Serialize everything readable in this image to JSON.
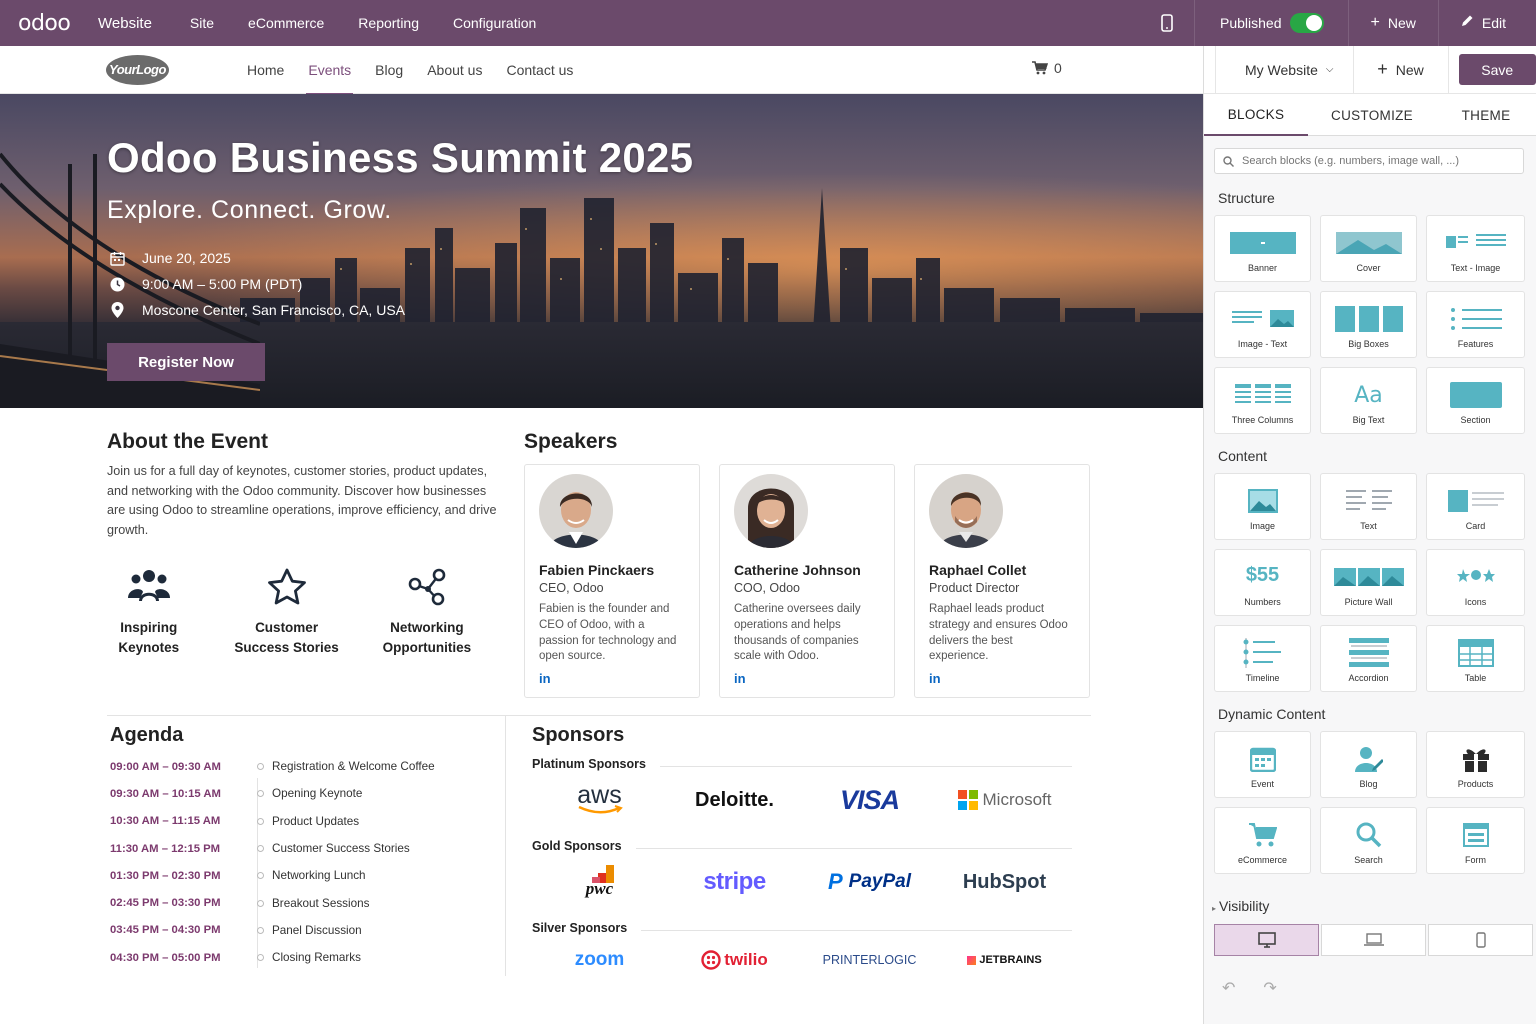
{
  "topbar": {
    "brand": "odoo",
    "app": "Website",
    "menus": [
      "Site",
      "eCommerce",
      "Reporting",
      "Configuration"
    ],
    "published_label": "Published",
    "new_label": "New",
    "edit_label": "Edit"
  },
  "site": {
    "logo": "YourLogo",
    "nav": [
      "Home",
      "Events",
      "Blog",
      "About us",
      "Contact us"
    ],
    "active_nav": "Events",
    "cart_count": "0"
  },
  "hero": {
    "title": "Odoo Business Summit 2025",
    "subtitle": "Explore. Connect. Grow.",
    "date": "June 20, 2025",
    "time": "9:00 AM – 5:00 PM (PDT)",
    "location": "Moscone Center, San Francisco, CA, USA",
    "cta": "Register Now"
  },
  "about": {
    "title": "About the Event",
    "text": "Join us for a full day of keynotes, customer stories, product updates, and networking with the Odoo community. Discover how businesses are using Odoo to streamline operations, improve efficiency, and drive growth.",
    "features": [
      {
        "line1": "Inspiring",
        "line2": "Keynotes",
        "icon": "people-icon"
      },
      {
        "line1": "Customer",
        "line2": "Success Stories",
        "icon": "star-icon"
      },
      {
        "line1": "Networking",
        "line2": "Opportunities",
        "icon": "network-icon"
      }
    ]
  },
  "speakers": {
    "title": "Speakers",
    "items": [
      {
        "name": "Fabien Pinckaers",
        "role": "CEO, Odoo",
        "bio": "Fabien is the founder and CEO of Odoo, with a passion for technology and open source.",
        "link": "in"
      },
      {
        "name": "Catherine Johnson",
        "role": "COO, Odoo",
        "bio": "Catherine oversees daily operations and helps thousands of companies scale with Odoo.",
        "link": "in"
      },
      {
        "name": "Raphael Collet",
        "role": "Product Director",
        "bio": "Raphael leads product strategy and ensures Odoo delivers the best experience.",
        "link": "in"
      }
    ]
  },
  "agenda": {
    "title": "Agenda",
    "items": [
      {
        "time": "09:00 AM – 09:30 AM",
        "title": "Registration & Welcome Coffee"
      },
      {
        "time": "09:30 AM – 10:15 AM",
        "title": "Opening Keynote"
      },
      {
        "time": "10:30 AM – 11:15 AM",
        "title": "Product Updates"
      },
      {
        "time": "11:30 AM – 12:15 PM",
        "title": "Customer Success Stories"
      },
      {
        "time": "01:30 PM – 02:30 PM",
        "title": "Networking Lunch"
      },
      {
        "time": "02:45 PM – 03:30 PM",
        "title": "Breakout Sessions"
      },
      {
        "time": "03:45 PM – 04:30 PM",
        "title": "Panel Discussion"
      },
      {
        "time": "04:30 PM – 05:00 PM",
        "title": "Closing Remarks"
      }
    ]
  },
  "sponsors": {
    "title": "Sponsors",
    "tiers": [
      {
        "name": "Platinum Sponsors",
        "logos": [
          "aws",
          "Deloitte.",
          "VISA",
          "Microsoft"
        ]
      },
      {
        "name": "Gold Sponsors",
        "logos": [
          "pwc",
          "stripe",
          "PayPal",
          "HubSpot"
        ]
      },
      {
        "name": "Silver Sponsors",
        "logos": [
          "zoom",
          "twilio",
          "PRINTERLOGIC",
          "JETBRAINS"
        ]
      }
    ]
  },
  "panel": {
    "website_select": "My Website",
    "new_label": "New",
    "save_label": "Save",
    "tabs": [
      "BLOCKS",
      "CUSTOMIZE",
      "THEME"
    ],
    "active_tab": "BLOCKS",
    "search_placeholder": "Search blocks (e.g. numbers, image wall, ...)",
    "sections": [
      {
        "title": "Structure",
        "blocks": [
          "Banner",
          "Cover",
          "Text - Image",
          "Image - Text",
          "Big Boxes",
          "Features",
          "Three Columns",
          "Big Text",
          "Section"
        ]
      },
      {
        "title": "Content",
        "blocks": [
          "Image",
          "Text",
          "Card",
          "Numbers",
          "Picture Wall",
          "Icons",
          "Timeline",
          "Accordion",
          "Table"
        ]
      },
      {
        "title": "Dynamic Content",
        "blocks": [
          "Event",
          "Blog",
          "Products",
          "eCommerce",
          "Search",
          "Form"
        ]
      }
    ],
    "numbers_sample": "$55",
    "big_text_sample": "Aa",
    "visibility_label": "Visibility",
    "visibility_active": "desktop"
  },
  "colors": {
    "brand": "#6b4a6b",
    "accent_teal": "#4bb3c3",
    "agenda_time": "#7c3a6e",
    "linkedin": "#0a66c2"
  }
}
